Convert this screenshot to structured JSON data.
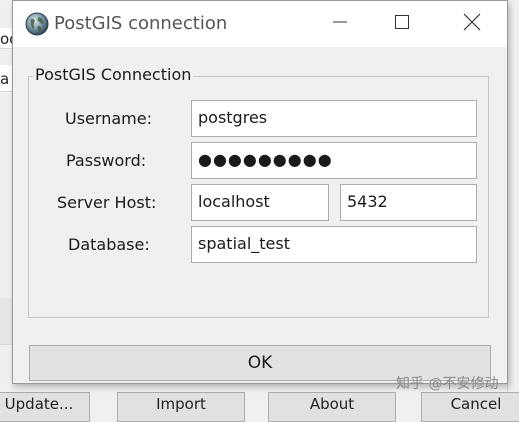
{
  "background_window": {
    "left_texts": [
      "oc",
      "a"
    ],
    "bottom_buttons": [
      "Update...",
      "Import",
      "About",
      "Cancel"
    ]
  },
  "dialog": {
    "title": "PostGIS connection",
    "title_icon": "globe-icon",
    "window_controls": [
      "minimize-icon",
      "maximize-icon",
      "close-icon"
    ]
  },
  "group": {
    "legend": "PostGIS Connection"
  },
  "form": {
    "username_label": "Username:",
    "username_value": "postgres",
    "password_label": "Password:",
    "password_value": "●●●●●●●●●",
    "server_host_label": "Server Host:",
    "server_host_value": "localhost",
    "port_value": "5432",
    "database_label": "Database:",
    "database_value": "spatial_test"
  },
  "ok_label": "OK",
  "watermark": "知乎 @不安修动"
}
